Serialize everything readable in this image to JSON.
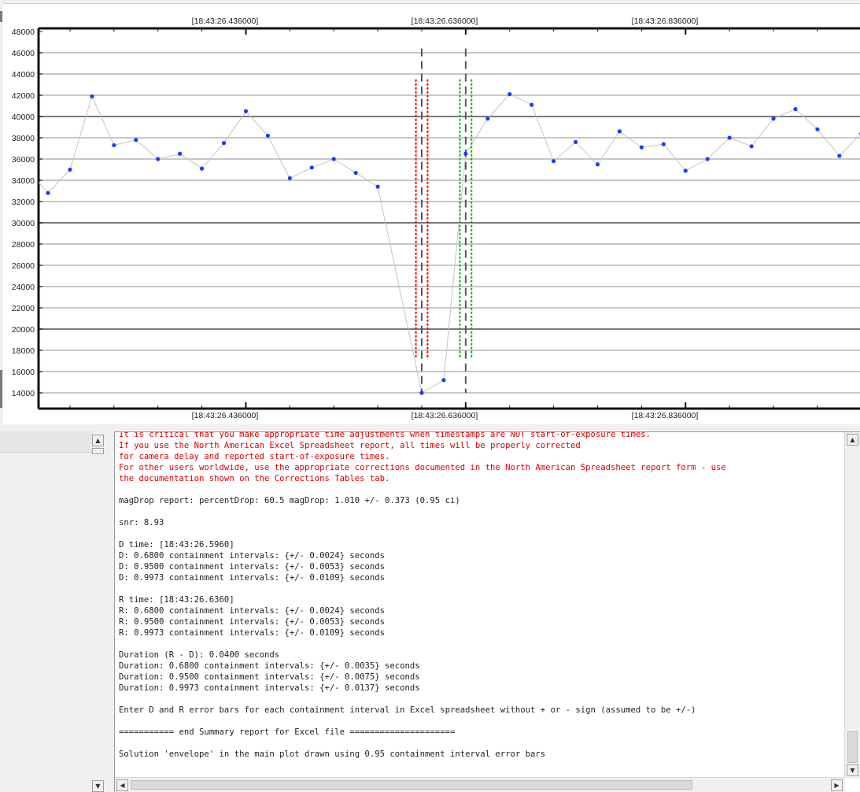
{
  "plot": {
    "top_axis_labels": [
      "[18:43:26.436000]",
      "[18:43:26.636000]",
      "[18:43:26.836000]"
    ],
    "bottom_axis_labels": [
      "[18:43:26.436000]",
      "[18:43:26.636000]",
      "[18:43:26.836000]"
    ]
  },
  "chart_data": {
    "type": "line",
    "title": "",
    "xlabel": "",
    "ylabel": "",
    "ylim": [
      13000,
      48000
    ],
    "yticks": [
      14000,
      16000,
      18000,
      20000,
      22000,
      24000,
      26000,
      28000,
      30000,
      32000,
      34000,
      36000,
      38000,
      40000,
      42000,
      44000,
      46000,
      48000
    ],
    "ytick_labels": [
      "14000",
      "16000",
      "18000",
      "20000",
      "22000",
      "24000",
      "26000",
      "28000",
      "30000",
      "32000",
      "34000",
      "36000",
      "38000",
      "40000",
      "42000",
      "44000",
      "46000",
      "48000"
    ],
    "major_gridlines": [
      20000,
      30000,
      40000
    ],
    "grid": true,
    "x_unit": "seconds after 18:43:26",
    "x_range": [
      0.246,
      1.006
    ],
    "xticks_major": [
      0.436,
      0.636,
      0.836
    ],
    "series": [
      {
        "color": "#1a3cff",
        "line_color": "#c4c4c4",
        "points": [
          [
            0.256,
            32800
          ],
          [
            0.276,
            35000
          ],
          [
            0.296,
            41900
          ],
          [
            0.316,
            37300
          ],
          [
            0.336,
            37800
          ],
          [
            0.356,
            36000
          ],
          [
            0.376,
            36500
          ],
          [
            0.396,
            35100
          ],
          [
            0.416,
            37500
          ],
          [
            0.436,
            40500
          ],
          [
            0.456,
            38200
          ],
          [
            0.476,
            34200
          ],
          [
            0.496,
            35200
          ],
          [
            0.516,
            36000
          ],
          [
            0.536,
            34700
          ],
          [
            0.556,
            33400
          ],
          [
            0.596,
            14000
          ],
          [
            0.616,
            15200
          ],
          [
            0.636,
            36500
          ],
          [
            0.656,
            39800
          ],
          [
            0.676,
            42100
          ],
          [
            0.696,
            41100
          ],
          [
            0.716,
            35800
          ],
          [
            0.736,
            37600
          ],
          [
            0.756,
            35500
          ],
          [
            0.776,
            38600
          ],
          [
            0.796,
            37100
          ],
          [
            0.816,
            37400
          ],
          [
            0.836,
            34900
          ],
          [
            0.856,
            36000
          ],
          [
            0.876,
            38000
          ],
          [
            0.896,
            37200
          ],
          [
            0.916,
            39800
          ],
          [
            0.936,
            40700
          ],
          [
            0.956,
            38800
          ],
          [
            0.976,
            36300
          ],
          [
            0.996,
            38400
          ]
        ],
        "line_extends_to": [
          1.006,
          40700
        ]
      }
    ],
    "vertical_markers": [
      {
        "kind": "D",
        "x": 0.596,
        "color": "#555555",
        "style": "dashed",
        "y_range": [
          14000,
          46400
        ]
      },
      {
        "kind": "R",
        "x": 0.636,
        "color": "#555555",
        "style": "dashed",
        "y_range": [
          14000,
          46400
        ]
      },
      {
        "kind": "D-error",
        "x": 0.5907,
        "color": "#ff0000",
        "style": "dotted",
        "y_range": [
          17300,
          43500
        ]
      },
      {
        "kind": "D-error",
        "x": 0.6013,
        "color": "#ff0000",
        "style": "dotted",
        "y_range": [
          17300,
          43500
        ]
      },
      {
        "kind": "R-error",
        "x": 0.6307,
        "color": "#00bb00",
        "style": "dotted",
        "y_range": [
          17300,
          43500
        ]
      },
      {
        "kind": "R-error",
        "x": 0.6413,
        "color": "#00bb00",
        "style": "dotted",
        "y_range": [
          17300,
          43500
        ]
      }
    ]
  },
  "report": {
    "lines": [
      {
        "text": "It is critical that you make appropriate time adjustments when timestamps are NOT start-of-exposure times.",
        "color": "red"
      },
      {
        "text": "If you use the North American Excel Spreadsheet report, all times will be properly corrected",
        "color": "red"
      },
      {
        "text": "for camera delay and reported start-of-exposure times.",
        "color": "red"
      },
      {
        "text": "For other users worldwide, use the appropriate corrections documented in the North American Spreadsheet report form - use",
        "color": "red"
      },
      {
        "text": "the documentation shown on the Corrections Tables tab.",
        "color": "red"
      },
      {
        "text": "",
        "color": "black"
      },
      {
        "text": "magDrop report: percentDrop: 60.5 magDrop: 1.010 +/- 0.373 (0.95 ci)",
        "color": "black"
      },
      {
        "text": "",
        "color": "black"
      },
      {
        "text": "snr: 8.93",
        "color": "black"
      },
      {
        "text": "",
        "color": "black"
      },
      {
        "text": "D time: [18:43:26.5960]",
        "color": "black"
      },
      {
        "text": "D: 0.6800 containment intervals: {+/- 0.0024} seconds",
        "color": "black"
      },
      {
        "text": "D: 0.9500 containment intervals: {+/- 0.0053} seconds",
        "color": "black"
      },
      {
        "text": "D: 0.9973 containment intervals: {+/- 0.0109} seconds",
        "color": "black"
      },
      {
        "text": "",
        "color": "black"
      },
      {
        "text": "R time: [18:43:26.6360]",
        "color": "black"
      },
      {
        "text": "R: 0.6800 containment intervals: {+/- 0.0024} seconds",
        "color": "black"
      },
      {
        "text": "R: 0.9500 containment intervals: {+/- 0.0053} seconds",
        "color": "black"
      },
      {
        "text": "R: 0.9973 containment intervals: {+/- 0.0109} seconds",
        "color": "black"
      },
      {
        "text": "",
        "color": "black"
      },
      {
        "text": "Duration (R - D): 0.0400 seconds",
        "color": "black"
      },
      {
        "text": "Duration: 0.6800 containment intervals: {+/- 0.0035} seconds",
        "color": "black"
      },
      {
        "text": "Duration: 0.9500 containment intervals: {+/- 0.0075} seconds",
        "color": "black"
      },
      {
        "text": "Duration: 0.9973 containment intervals: {+/- 0.0137} seconds",
        "color": "black"
      },
      {
        "text": "",
        "color": "black"
      },
      {
        "text": "Enter D and R error bars for each containment interval in Excel spreadsheet without + or - sign (assumed to be +/-)",
        "color": "black"
      },
      {
        "text": "",
        "color": "black"
      },
      {
        "text": "=========== end Summary report for Excel file =====================",
        "color": "black"
      },
      {
        "text": "",
        "color": "black"
      },
      {
        "text": "Solution 'envelope' in the main plot drawn using 0.95 containment interval error bars",
        "color": "black"
      }
    ]
  },
  "scrollbars": {
    "up_arrow": "▲",
    "down_arrow": "▼",
    "left_arrow": "◀",
    "right_arrow": "▶"
  }
}
